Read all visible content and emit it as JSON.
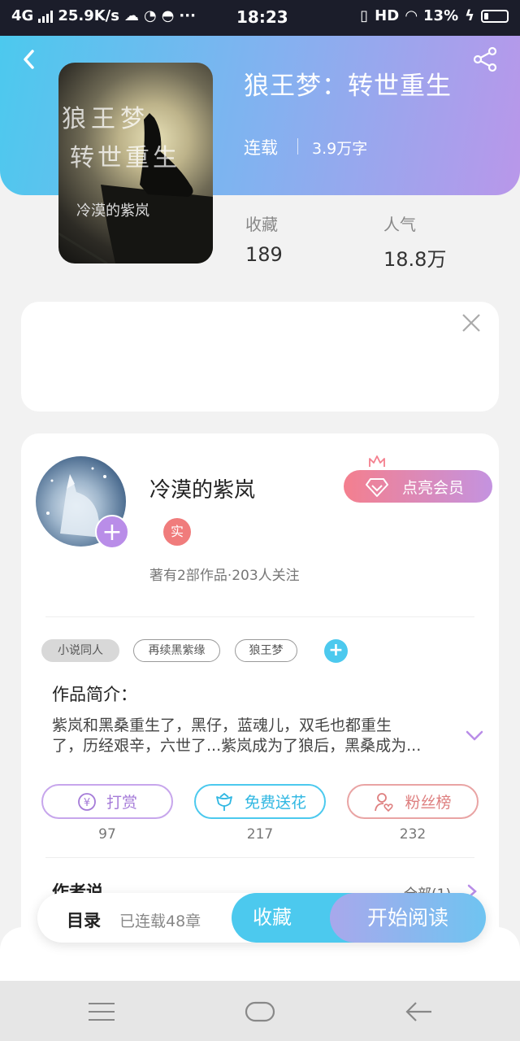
{
  "status_bar": {
    "network": "4G",
    "speed": "25.9K/s",
    "time": "18:23",
    "hd": "HD",
    "battery": "13%"
  },
  "header": {
    "book_title": "狼王梦：转世重生",
    "status": "连载",
    "word_count": "3.9万字",
    "cover_title_1": "狼王梦",
    "cover_title_2": "转世重生",
    "cover_author": "冷漠的紫岚"
  },
  "stats": {
    "favorites_label": "收藏",
    "favorites_value": "189",
    "popularity_label": "人气",
    "popularity_value": "18.8万"
  },
  "author": {
    "name": "冷漠的紫岚",
    "badge": "实",
    "meta": "著有2部作品·203人关注",
    "vip_button": "点亮会员"
  },
  "tags": [
    "小说同人",
    "再续黑紫缘",
    "狼王梦"
  ],
  "intro": {
    "label": "作品简介：",
    "line1": "紫岚和黑桑重生了，黑仔，蓝魂儿，双毛也都重生",
    "line2": "了，历经艰辛，六世了...紫岚成为了狼后，黑桑成为..."
  },
  "actions": [
    {
      "label": "打赏",
      "count": "97",
      "color": "#b98de8"
    },
    {
      "label": "免费送花",
      "count": "217",
      "color": "#4cc9ee"
    },
    {
      "label": "粉丝榜",
      "count": "232",
      "color": "#e68a8a"
    }
  ],
  "author_says": {
    "label": "作者说",
    "all": "全部(1)"
  },
  "bottom_bar": {
    "toc_label": "目录",
    "toc_sub": "已连载48章",
    "collect": "收藏",
    "read": "开始阅读"
  },
  "colors": {
    "accent_blue": "#4cc9ee",
    "accent_purple": "#b98de8"
  }
}
